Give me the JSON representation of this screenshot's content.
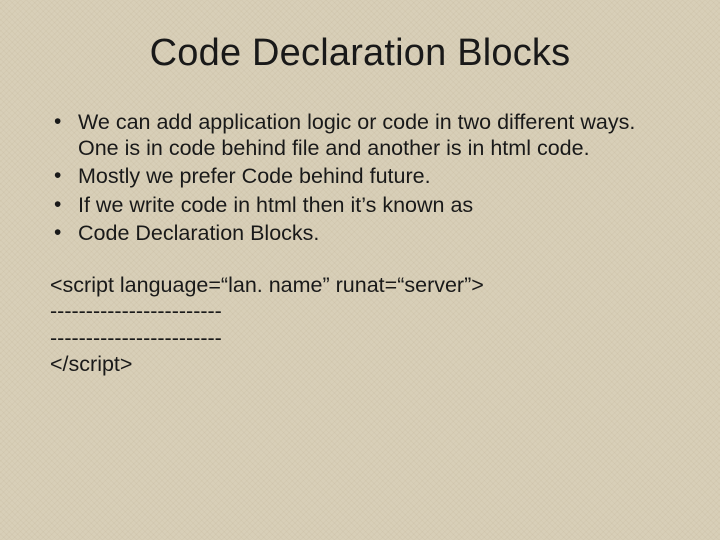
{
  "slide": {
    "title": "Code Declaration Blocks",
    "bullets": [
      "We can add application logic or code in two different ways. One is in code behind file and another is in html code.",
      "Mostly we prefer Code behind future.",
      "If we write code in html then it’s known as",
      "Code Declaration Blocks."
    ],
    "code": {
      "line1": "<script language=“lan. name” runat=“server”>",
      "line2": "------------------------",
      "line3": "------------------------",
      "line4": "</script>"
    }
  }
}
